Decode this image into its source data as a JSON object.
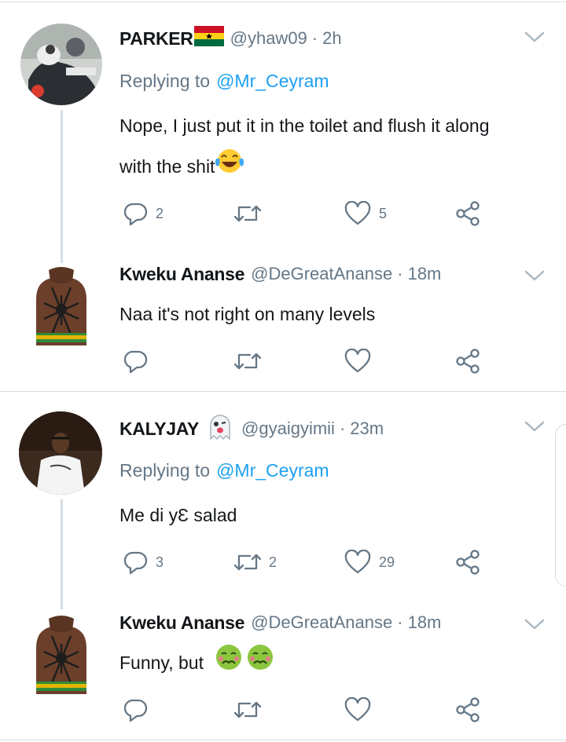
{
  "tweets": [
    {
      "name": "PARKER",
      "handle": "@yhaw09",
      "sep": "·",
      "time": "2h",
      "replying_label": "Replying to",
      "replying_handle": "@Mr_Ceyram",
      "text_line1": "Nope, I just put it in the toilet and flush it along",
      "text_line2": "with the shit",
      "reply_count": "2",
      "retweet_count": "",
      "like_count": "5"
    },
    {
      "name": "Kweku Ananse",
      "handle": "@DeGreatAnanse",
      "sep": "·",
      "time": "18m",
      "text": "Naa it's not right on many levels",
      "reply_count": "",
      "retweet_count": "",
      "like_count": ""
    },
    {
      "name": "KALYJAY",
      "handle": "@gyaigyimii",
      "sep": "·",
      "time": "23m",
      "replying_label": "Replying to",
      "replying_handle": "@Mr_Ceyram",
      "text": "Me di yƐ salad",
      "reply_count": "3",
      "retweet_count": "2",
      "like_count": "29"
    },
    {
      "name": "Kweku Ananse",
      "handle": "@DeGreatAnanse",
      "sep": "·",
      "time": "18m",
      "text": "Funny, but",
      "reply_count": "",
      "retweet_count": "",
      "like_count": ""
    }
  ],
  "icons": {
    "reply": "reply-icon",
    "retweet": "retweet-icon",
    "like": "like-icon",
    "share": "share-icon",
    "chevron": "chevron-down-icon",
    "flag": "ghana-flag-icon",
    "ghost": "ghost-emoji-icon",
    "laugh": "tears-of-joy-emoji-icon",
    "nauseated": "nauseated-face-emoji-icon"
  },
  "colors": {
    "link": "#1da1f2",
    "secondary_text": "#657786",
    "icon": "#657786",
    "divider": "#d9dee2"
  }
}
